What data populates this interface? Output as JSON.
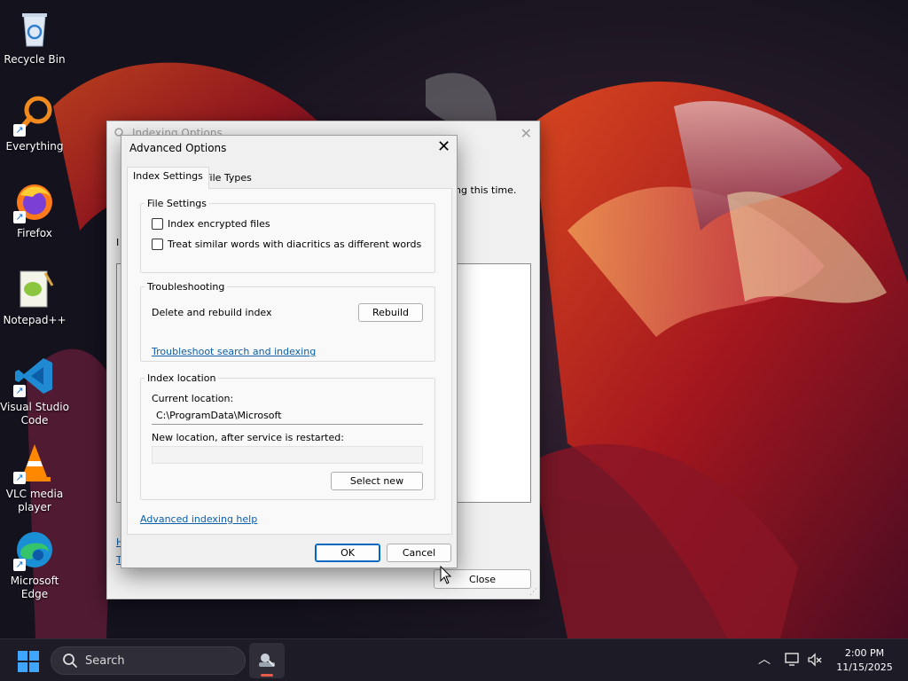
{
  "desktop": {
    "icons": [
      {
        "label": "Recycle Bin",
        "icon": "recycle-bin-icon"
      },
      {
        "label": "Everything",
        "icon": "everything-search-icon"
      },
      {
        "label": "Firefox",
        "icon": "firefox-icon"
      },
      {
        "label": "Notepad++",
        "icon": "notepad-plus-plus-icon"
      },
      {
        "label": "Visual Studio Code",
        "icon": "vscode-icon"
      },
      {
        "label": "VLC media player",
        "icon": "vlc-icon"
      },
      {
        "label": "Microsoft Edge",
        "icon": "edge-icon"
      }
    ]
  },
  "indexing_window": {
    "title": "Indexing Options",
    "message_fragment": "ng this time.",
    "label_fragment": "I",
    "link_fragment_1": "H",
    "link_fragment_2": "T",
    "close_button": "Close"
  },
  "advanced_dialog": {
    "title": "Advanced Options",
    "tabs": [
      {
        "label": "Index Settings",
        "active": true
      },
      {
        "label": "File Types",
        "active": false
      }
    ],
    "file_settings": {
      "legend": "File Settings",
      "options": [
        {
          "label": "Index encrypted files",
          "checked": false
        },
        {
          "label": "Treat similar words with diacritics as different words",
          "checked": false
        }
      ]
    },
    "troubleshooting": {
      "legend": "Troubleshooting",
      "rebuild_label": "Delete and rebuild index",
      "rebuild_button": "Rebuild",
      "troubleshoot_link": "Troubleshoot search and indexing"
    },
    "index_location": {
      "legend": "Index location",
      "current_label": "Current location:",
      "current_value": "C:\\ProgramData\\Microsoft",
      "new_label": "New location, after service is restarted:",
      "new_value": "",
      "select_new_button": "Select new"
    },
    "help_link": "Advanced indexing help",
    "ok_button": "OK",
    "cancel_button": "Cancel"
  },
  "taskbar": {
    "search_placeholder": "Search",
    "time": "2:00 PM",
    "date": "11/15/2025"
  },
  "colors": {
    "accent": "#0067c0",
    "link": "#0b5ea8",
    "taskbar": "#1d1c26"
  }
}
